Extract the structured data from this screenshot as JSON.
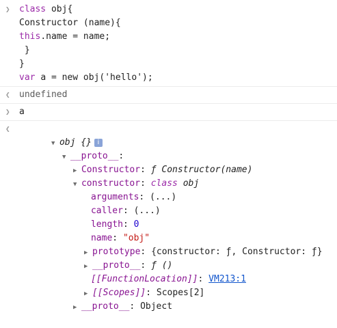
{
  "input": {
    "lines": [
      {
        "kw": "class ",
        "rest": "obj{"
      },
      {
        "kw": "",
        "rest": "Constructor (name){"
      },
      {
        "kw": "this",
        "rest": ".name = name;"
      },
      {
        "kw": "",
        "rest": " }"
      },
      {
        "kw": "",
        "rest": "}"
      },
      {
        "kw": "var ",
        "rest": "a = new obj('hello');"
      }
    ]
  },
  "result1": "undefined",
  "input2": "a",
  "tree": {
    "root_name": "obj",
    "root_braces": "{}",
    "info_badge": "i",
    "proto_label": "__proto__",
    "proto_suffix": ":",
    "Constructor": {
      "key": "Constructor",
      "colon": ":",
      "f_glyph": "ƒ",
      "value": "Constructor(name)"
    },
    "constructor": {
      "key": "constructor",
      "colon": ":",
      "kw": "class",
      "value": "obj"
    },
    "arguments": {
      "key": "arguments",
      "colon": ":",
      "value": "(...)"
    },
    "caller": {
      "key": "caller",
      "colon": ":",
      "value": "(...)"
    },
    "length": {
      "key": "length",
      "colon": ":",
      "value": "0"
    },
    "name": {
      "key": "name",
      "colon": ":",
      "value": "\"obj\""
    },
    "prototype": {
      "key": "prototype",
      "colon": ":",
      "value": "{constructor: ƒ, Constructor: ƒ}"
    },
    "proto_inner": {
      "key": "__proto__",
      "colon": ":",
      "value": "ƒ ()"
    },
    "function_location": {
      "key": "[[FunctionLocation]]",
      "colon": ":",
      "link": "VM213:1"
    },
    "scopes": {
      "key": "[[Scopes]]",
      "colon": ":",
      "value": "Scopes[2]"
    },
    "proto_outer": {
      "key": "__proto__",
      "colon": ":",
      "value": "Object"
    }
  }
}
